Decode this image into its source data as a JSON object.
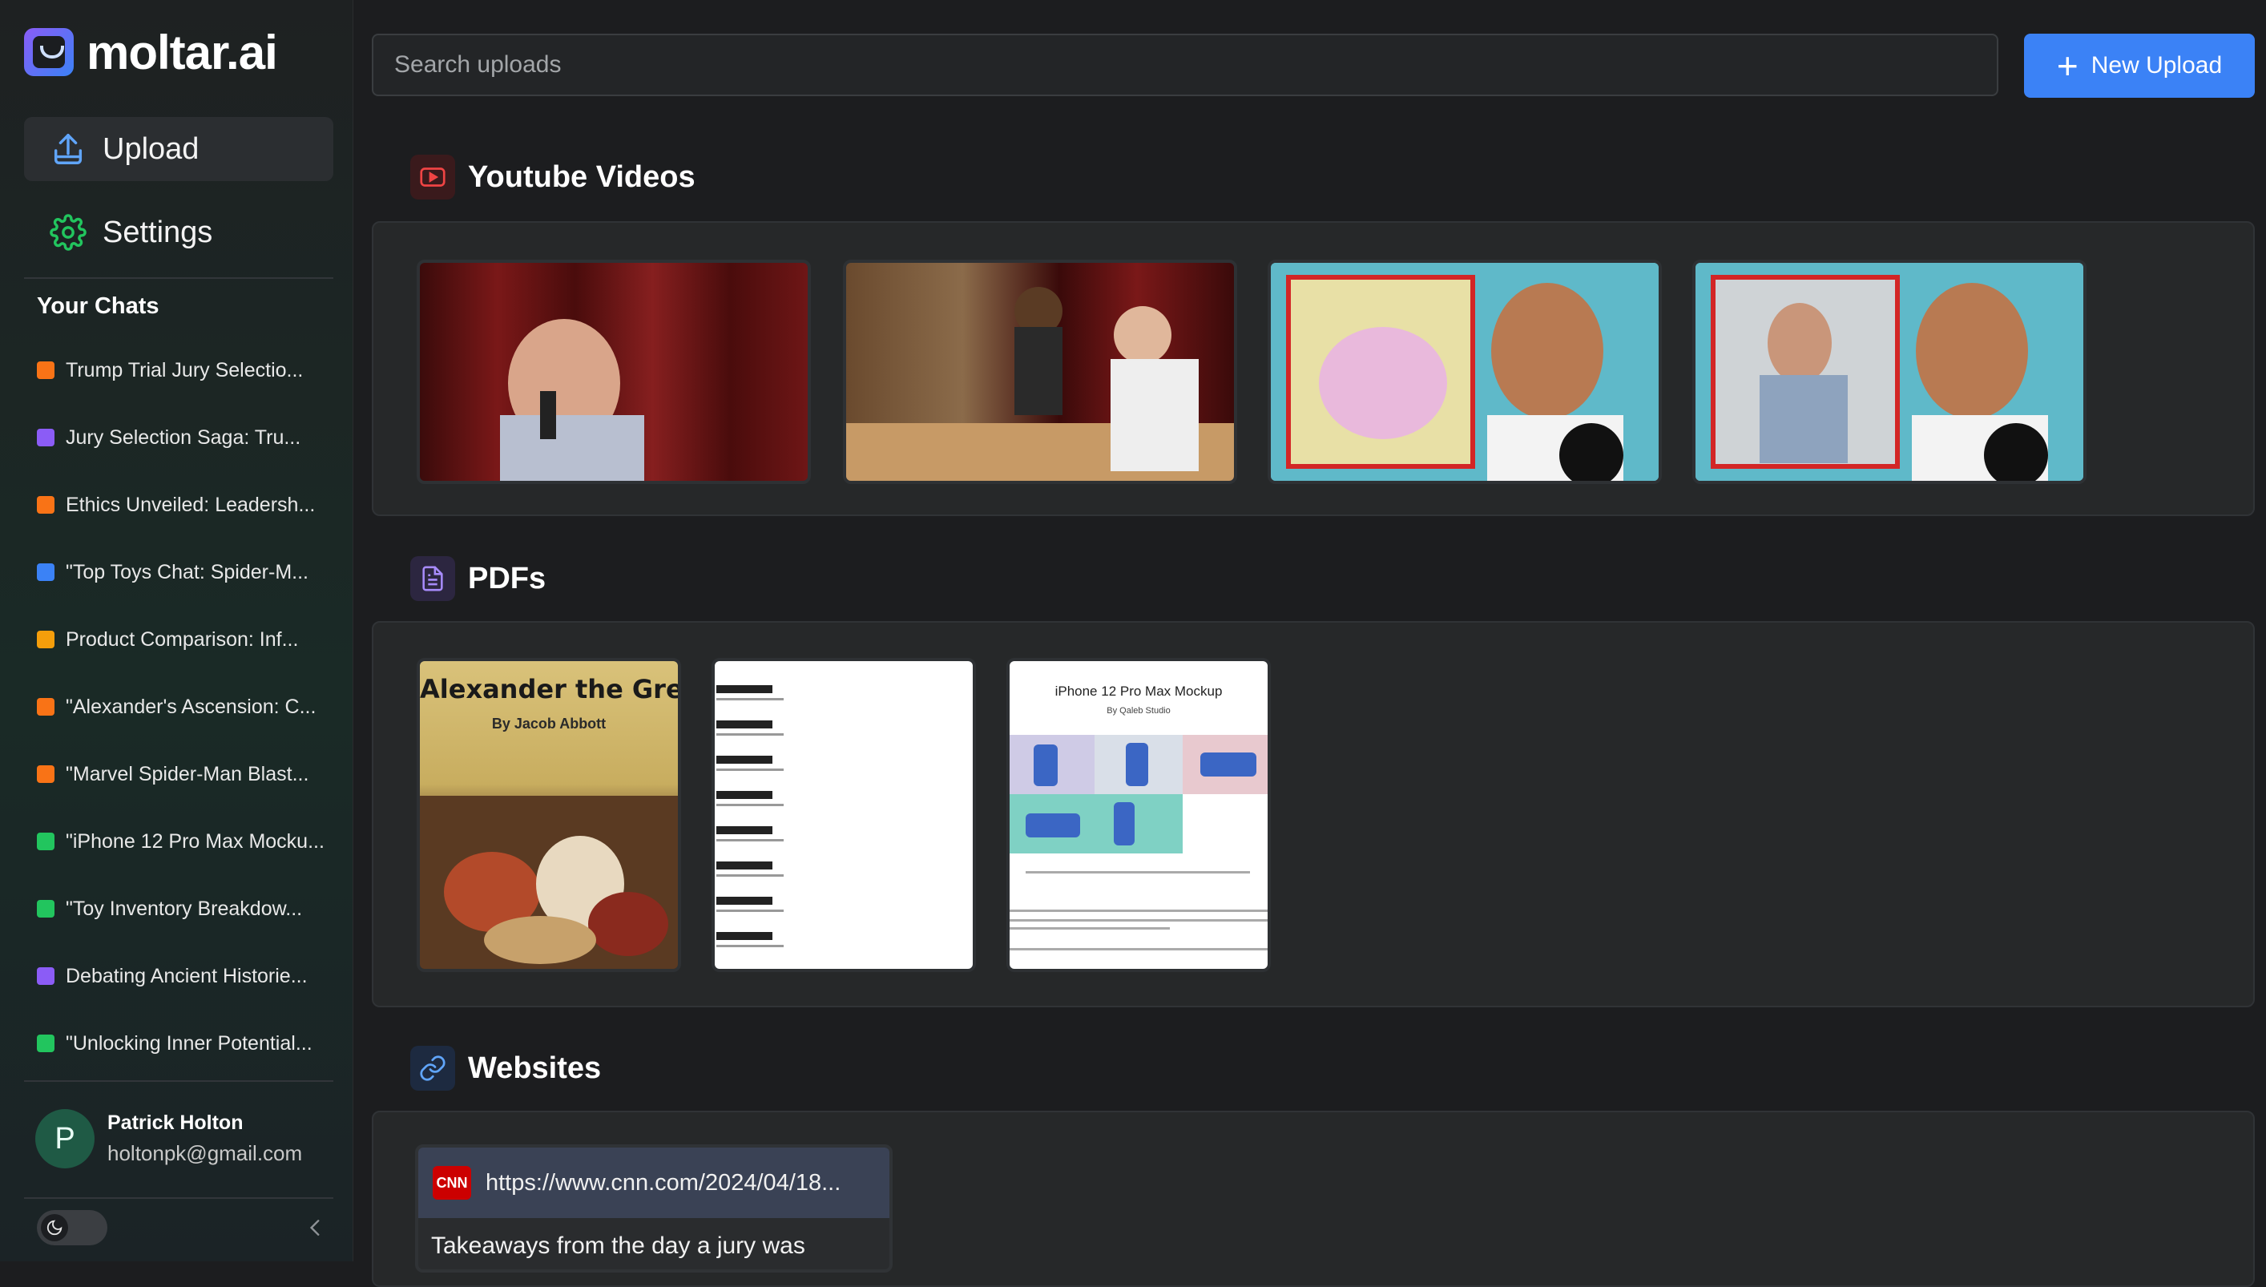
{
  "app": {
    "name": "moltar.ai"
  },
  "sidebar": {
    "nav": [
      {
        "label": "Upload",
        "icon": "upload-icon"
      },
      {
        "label": "Settings",
        "icon": "gear-icon"
      }
    ],
    "chats_title": "Your Chats",
    "chats": [
      {
        "label": "Trump Trial Jury Selectio...",
        "color": "#f97316"
      },
      {
        "label": "Jury Selection Saga: Tru...",
        "color": "#8b5cf6"
      },
      {
        "label": "Ethics Unveiled: Leadersh...",
        "color": "#f97316"
      },
      {
        "label": "\"Top Toys Chat: Spider-M...",
        "color": "#3b82f6"
      },
      {
        "label": "Product Comparison: Inf...",
        "color": "#f59e0b"
      },
      {
        "label": "\"Alexander's Ascension: C...",
        "color": "#f97316"
      },
      {
        "label": "\"Marvel Spider-Man Blast...",
        "color": "#f97316"
      },
      {
        "label": "\"iPhone 12 Pro Max Mocku...",
        "color": "#22c55e"
      },
      {
        "label": "\"Toy Inventory Breakdow...",
        "color": "#22c55e"
      },
      {
        "label": "Debating Ancient Historie...",
        "color": "#8b5cf6"
      },
      {
        "label": "\"Unlocking Inner Potential...",
        "color": "#22c55e"
      }
    ],
    "user": {
      "initial": "P",
      "name": "Patrick Holton",
      "email": "holtonpk@gmail.com"
    }
  },
  "topbar": {
    "search_placeholder": "Search uploads",
    "new_upload_label": "New Upload"
  },
  "sections": {
    "youtube": {
      "title": "Youtube Videos",
      "icon": "youtube-icon",
      "count": 4
    },
    "pdfs": {
      "title": "PDFs",
      "icon": "document-icon",
      "items": [
        {
          "cover_title": "Alexander the Great",
          "cover_author": "By Jacob Abbott"
        },
        {
          "cover_title": ""
        },
        {
          "cover_title": "iPhone 12 Pro Max Mockup",
          "cover_author": "By Qaleb Studio"
        }
      ]
    },
    "websites": {
      "title": "Websites",
      "icon": "link-icon",
      "items": [
        {
          "logo": "CNN",
          "url": "https://www.cnn.com/2024/04/18...",
          "title": "Takeaways from the day a jury was"
        }
      ]
    }
  },
  "colors": {
    "accent": "#3b82f6",
    "youtube": "#e11d1d",
    "pdf": "#8b5cf6",
    "link": "#3b82f6"
  }
}
